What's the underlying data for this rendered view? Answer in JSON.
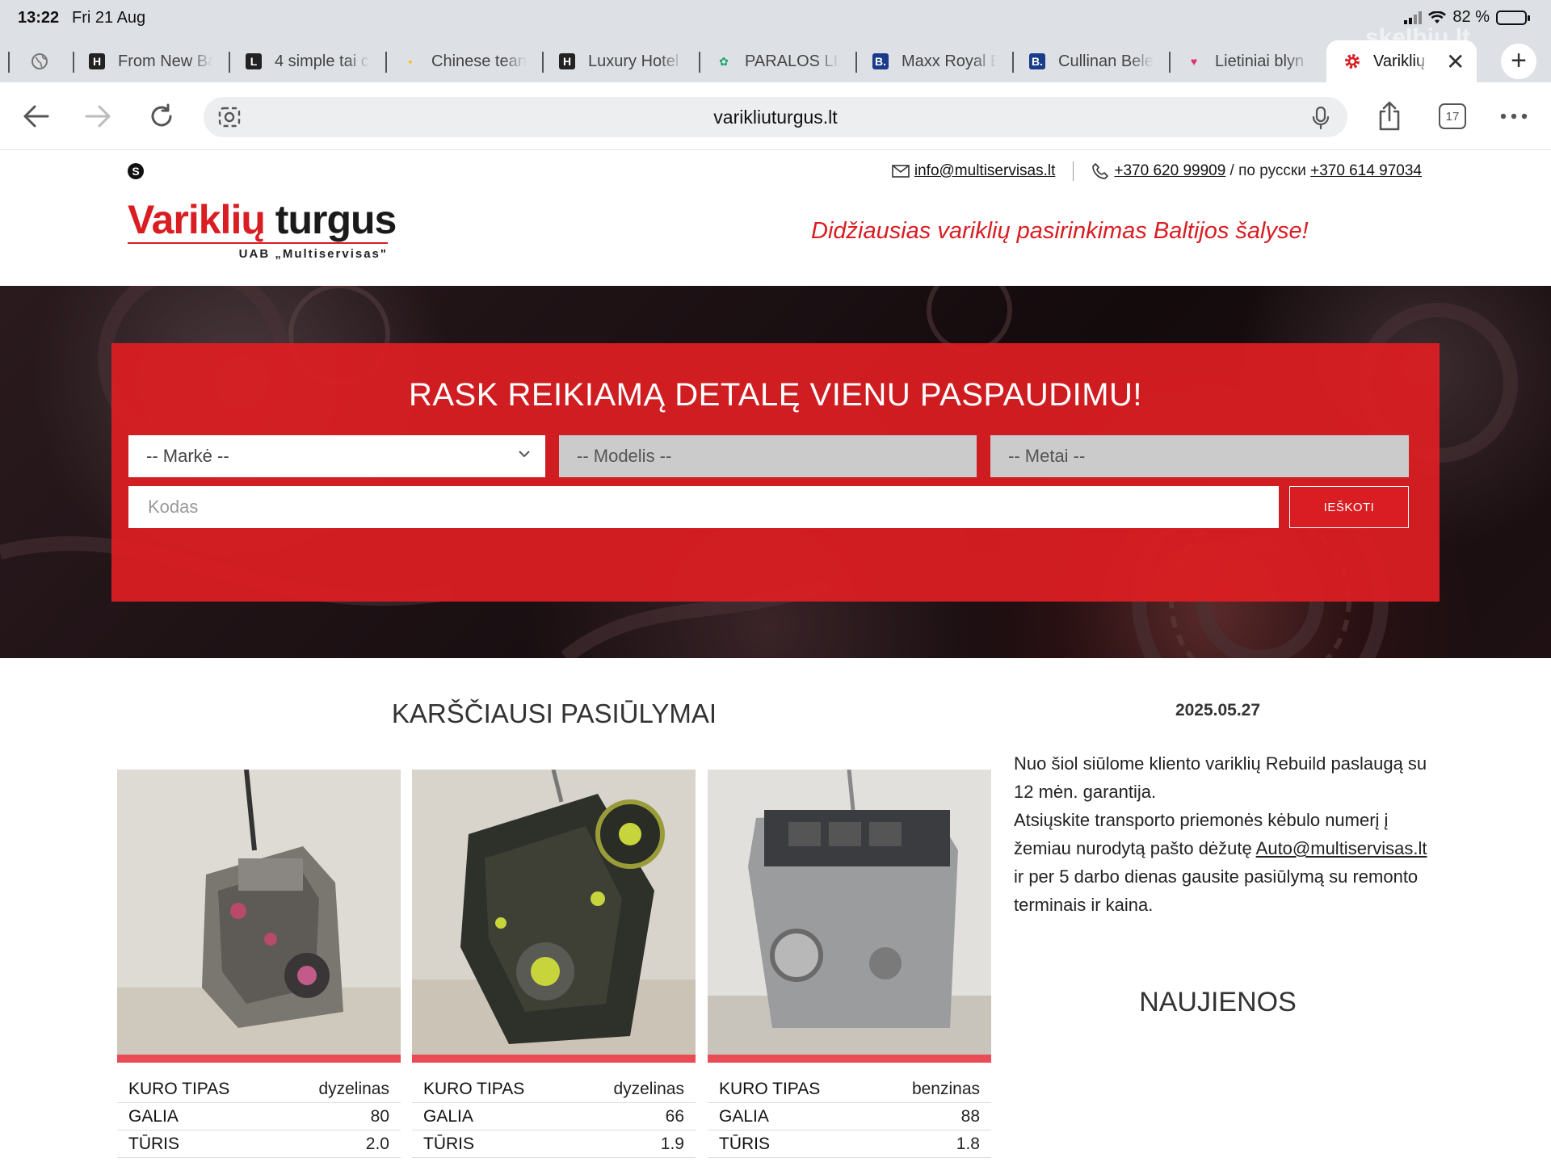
{
  "status": {
    "time": "13:22",
    "date": "Fri 21 Aug",
    "battery": "82 %"
  },
  "tabs": [
    {
      "title": "From New Ba",
      "fav": "H",
      "fav_color": "#222"
    },
    {
      "title": "4 simple tai c",
      "fav": "L",
      "fav_color": "#222"
    },
    {
      "title": "Chinese tean",
      "fav": "▪",
      "fav_color": "#f4c20d"
    },
    {
      "title": "Luxury Hotel",
      "fav": "H",
      "fav_color": "#222"
    },
    {
      "title": "PARALOS LIF",
      "fav": "✿",
      "fav_color": "#1aa36f"
    },
    {
      "title": "Maxx Royal E",
      "fav": "B.",
      "fav_color": "#1a3a8a"
    },
    {
      "title": "Cullinan Bele",
      "fav": "B.",
      "fav_color": "#1a3a8a"
    },
    {
      "title": "Lietiniai blyn",
      "fav": "♥",
      "fav_color": "#e0307a"
    }
  ],
  "active_tab": {
    "title": "Variklių t"
  },
  "watermark": "skelbiu.lt",
  "url": "varikliuturgus.lt",
  "tabs_count": "17",
  "header": {
    "email": "info@multiservisas.lt",
    "phone1": "+370 620 99909",
    "phone_sep": " / по русски ",
    "phone2": "+370 614 97034",
    "logo_red": "Variklių",
    "logo_dark": "turgus",
    "logo_sub": "UAB „Multiservisas\"",
    "tagline": "Didžiausias variklių pasirinkimas Baltijos šalyse!"
  },
  "search": {
    "title": "RASK REIKIAMĄ DETALĘ VIENU PASPAUDIMU!",
    "make": "-- Markė --",
    "model": "-- Modelis --",
    "year": "-- Metai --",
    "code_placeholder": "Kodas",
    "button": "IEŠKOTI"
  },
  "hot": {
    "title": "KARŠČIAUSI PASIŪLYMAI",
    "cards": [
      {
        "specs": [
          {
            "k": "KURO TIPAS",
            "v": "dyzelinas"
          },
          {
            "k": "GALIA",
            "v": "80"
          },
          {
            "k": "TŪRIS",
            "v": "2.0"
          }
        ]
      },
      {
        "specs": [
          {
            "k": "KURO TIPAS",
            "v": "dyzelinas"
          },
          {
            "k": "GALIA",
            "v": "66"
          },
          {
            "k": "TŪRIS",
            "v": "1.9"
          }
        ]
      },
      {
        "specs": [
          {
            "k": "KURO TIPAS",
            "v": "benzinas"
          },
          {
            "k": "GALIA",
            "v": "88"
          },
          {
            "k": "TŪRIS",
            "v": "1.8"
          }
        ]
      }
    ]
  },
  "news": {
    "date": "2025.05.27",
    "p1": "Nuo šiol siūlome kliento variklių Rebuild paslaugą su 12 mėn. garantija.",
    "p2a": "Atsiųskite transporto priemonės kėbulo numerį į žemiau nurodytą pašto dėžutę ",
    "link": "Auto@multiservisas.lt",
    "p2b": " ir per 5 darbo dienas gausite pasiūlymą su remonto terminais ir kaina.",
    "title": "NAUJIENOS"
  }
}
